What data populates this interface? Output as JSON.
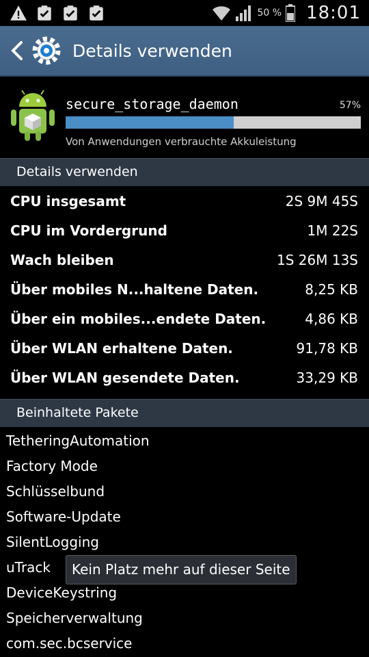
{
  "status_bar": {
    "battery_percent": "50 %",
    "time": "18:01",
    "icons": [
      "warning-icon",
      "clipboard-check-icon",
      "clipboard-check-icon",
      "clipboard-check-icon",
      "wifi-icon",
      "signal-icon",
      "battery-icon"
    ]
  },
  "action_bar": {
    "title": "Details verwenden"
  },
  "app": {
    "name": "secure_storage_daemon",
    "percent_label": "57%",
    "usage_fraction": 0.57,
    "subtitle": "Von Anwendungen verbrauchte Akkuleistung"
  },
  "details": {
    "header": "Details verwenden",
    "rows": [
      {
        "label": "CPU insgesamt",
        "value": "2S 9M 45S"
      },
      {
        "label": "CPU im Vordergrund",
        "value": "1M 22S"
      },
      {
        "label": "Wach bleiben",
        "value": "1S 26M 13S"
      },
      {
        "label": "Über mobiles N...haltene Daten.",
        "value": "8,25 KB"
      },
      {
        "label": "Über ein mobiles...endete Daten.",
        "value": "4,86 KB"
      },
      {
        "label": "Über WLAN erhaltene Daten.",
        "value": "91,78 KB"
      },
      {
        "label": "Über WLAN gesendete Daten.",
        "value": "33,29 KB"
      }
    ]
  },
  "packages": {
    "header": "Beinhaltete Pakete",
    "items": [
      "TetheringAutomation",
      "Factory Mode",
      "Schlüsselbund",
      "Software-Update",
      "SilentLogging",
      "uTrack",
      "DeviceKeystring",
      "Speicherverwaltung",
      "com.sec.bcservice"
    ]
  },
  "toast": {
    "text": "Kein Platz mehr auf dieser Seite"
  },
  "colors": {
    "action_bar": "#3e5f82",
    "progress_fill": "#4b8ec6",
    "section_header": "#2e3845"
  }
}
